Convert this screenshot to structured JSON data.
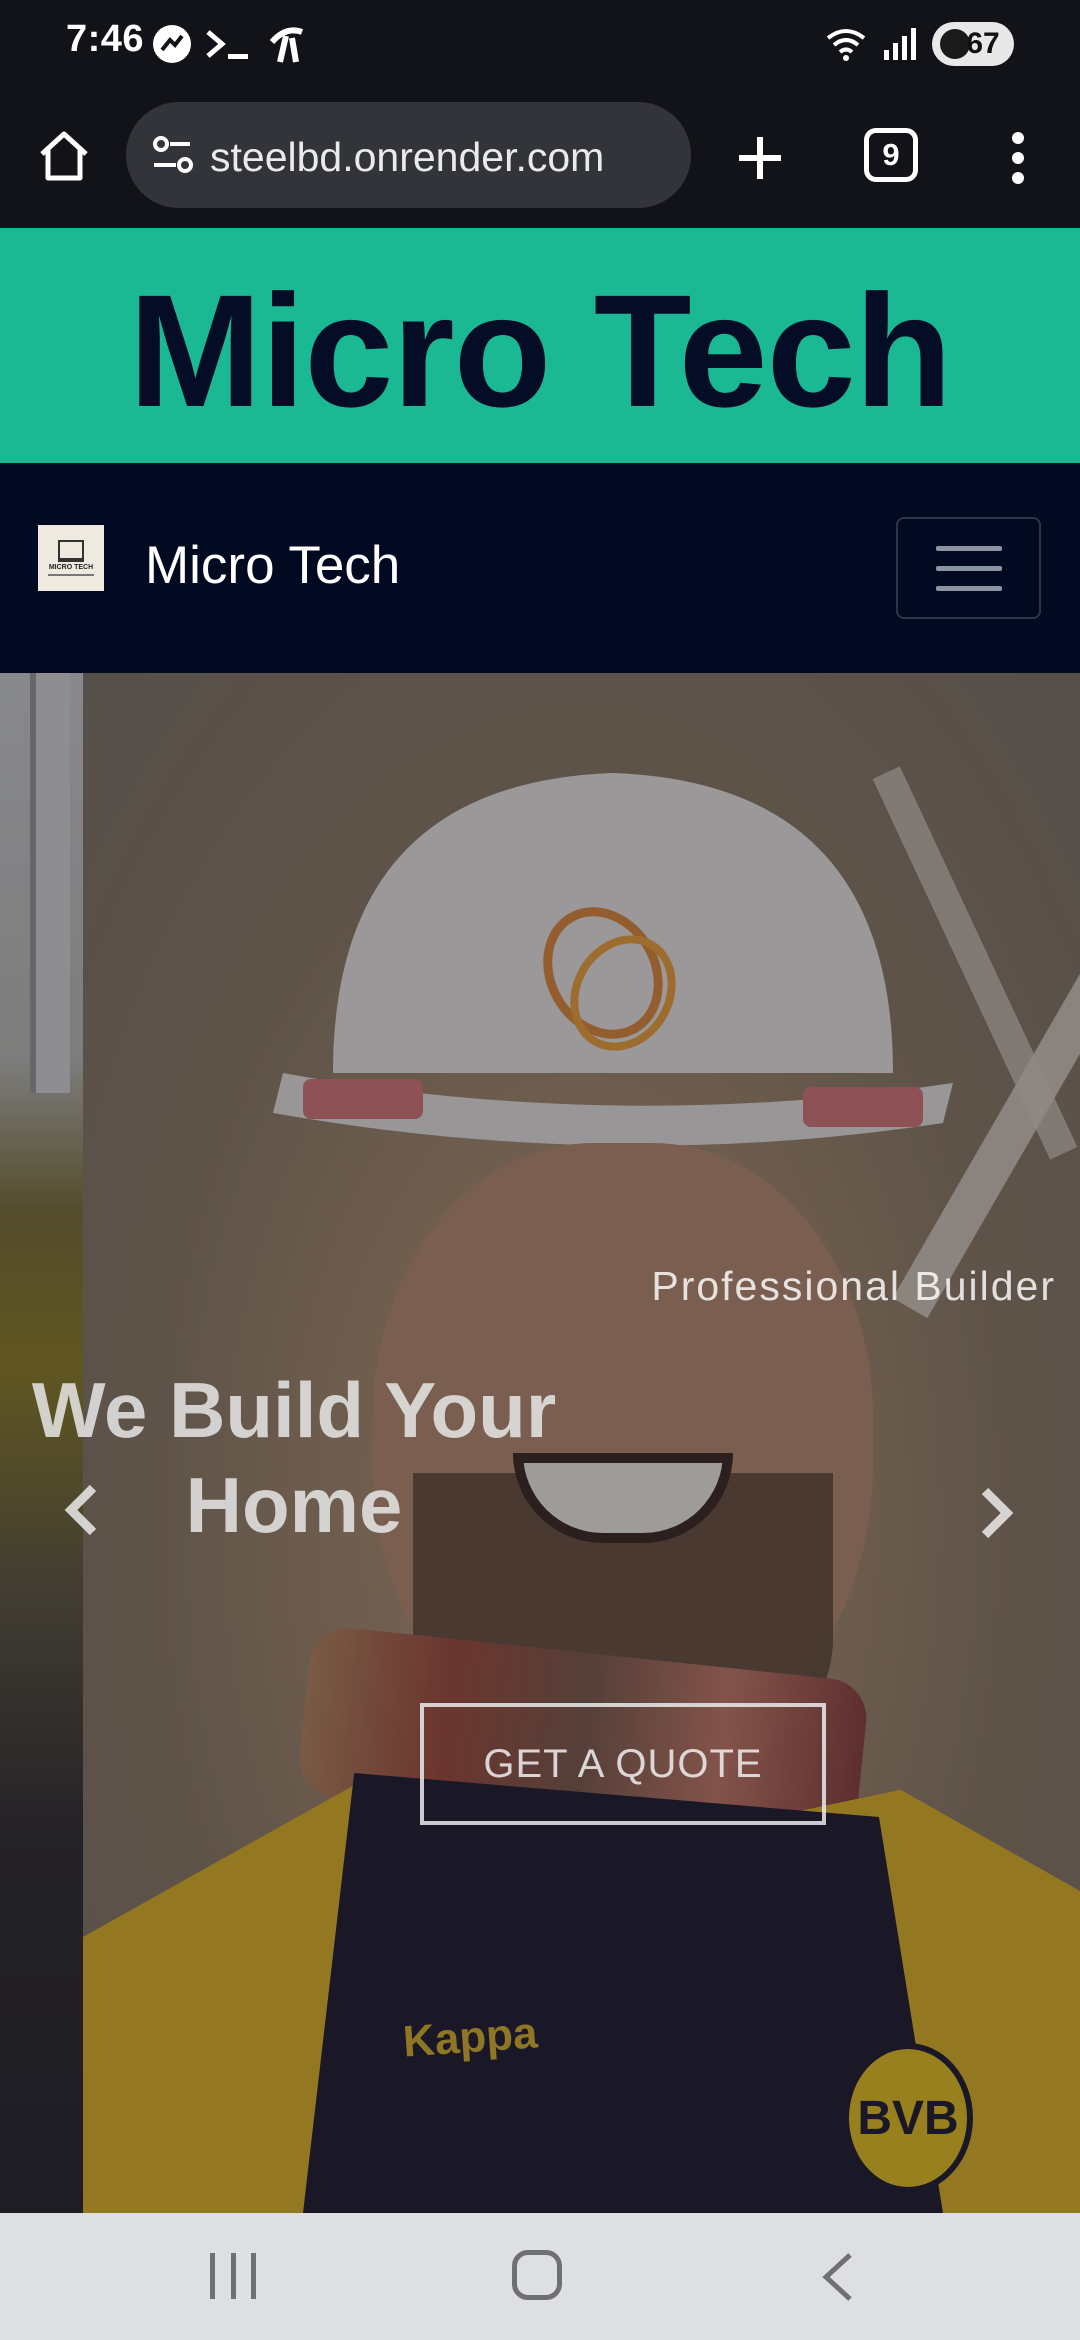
{
  "status_bar": {
    "time": "7:46",
    "left_icons": [
      "messenger-icon",
      "terminal-icon",
      "carrier-icon"
    ],
    "right_icons": [
      "wifi-icon",
      "signal-icon"
    ],
    "battery_level": "67"
  },
  "browser": {
    "url": "steelbd.onrender.com",
    "tab_count": "9"
  },
  "site": {
    "banner_title": "Micro Tech",
    "nav": {
      "brand_name": "Micro Tech",
      "logo_text": "MICRO TECH"
    },
    "hero": {
      "subtitle": "Professional Builder",
      "title": "We Build Your Home",
      "cta_label": "GET A QUOTE"
    },
    "jacket_text": "Kappa",
    "emblem_text": "BVB"
  },
  "colors": {
    "banner_bg": "#1bb894",
    "banner_text": "#050d26",
    "navbar_bg": "#020a21",
    "browser_bg": "#121318"
  }
}
